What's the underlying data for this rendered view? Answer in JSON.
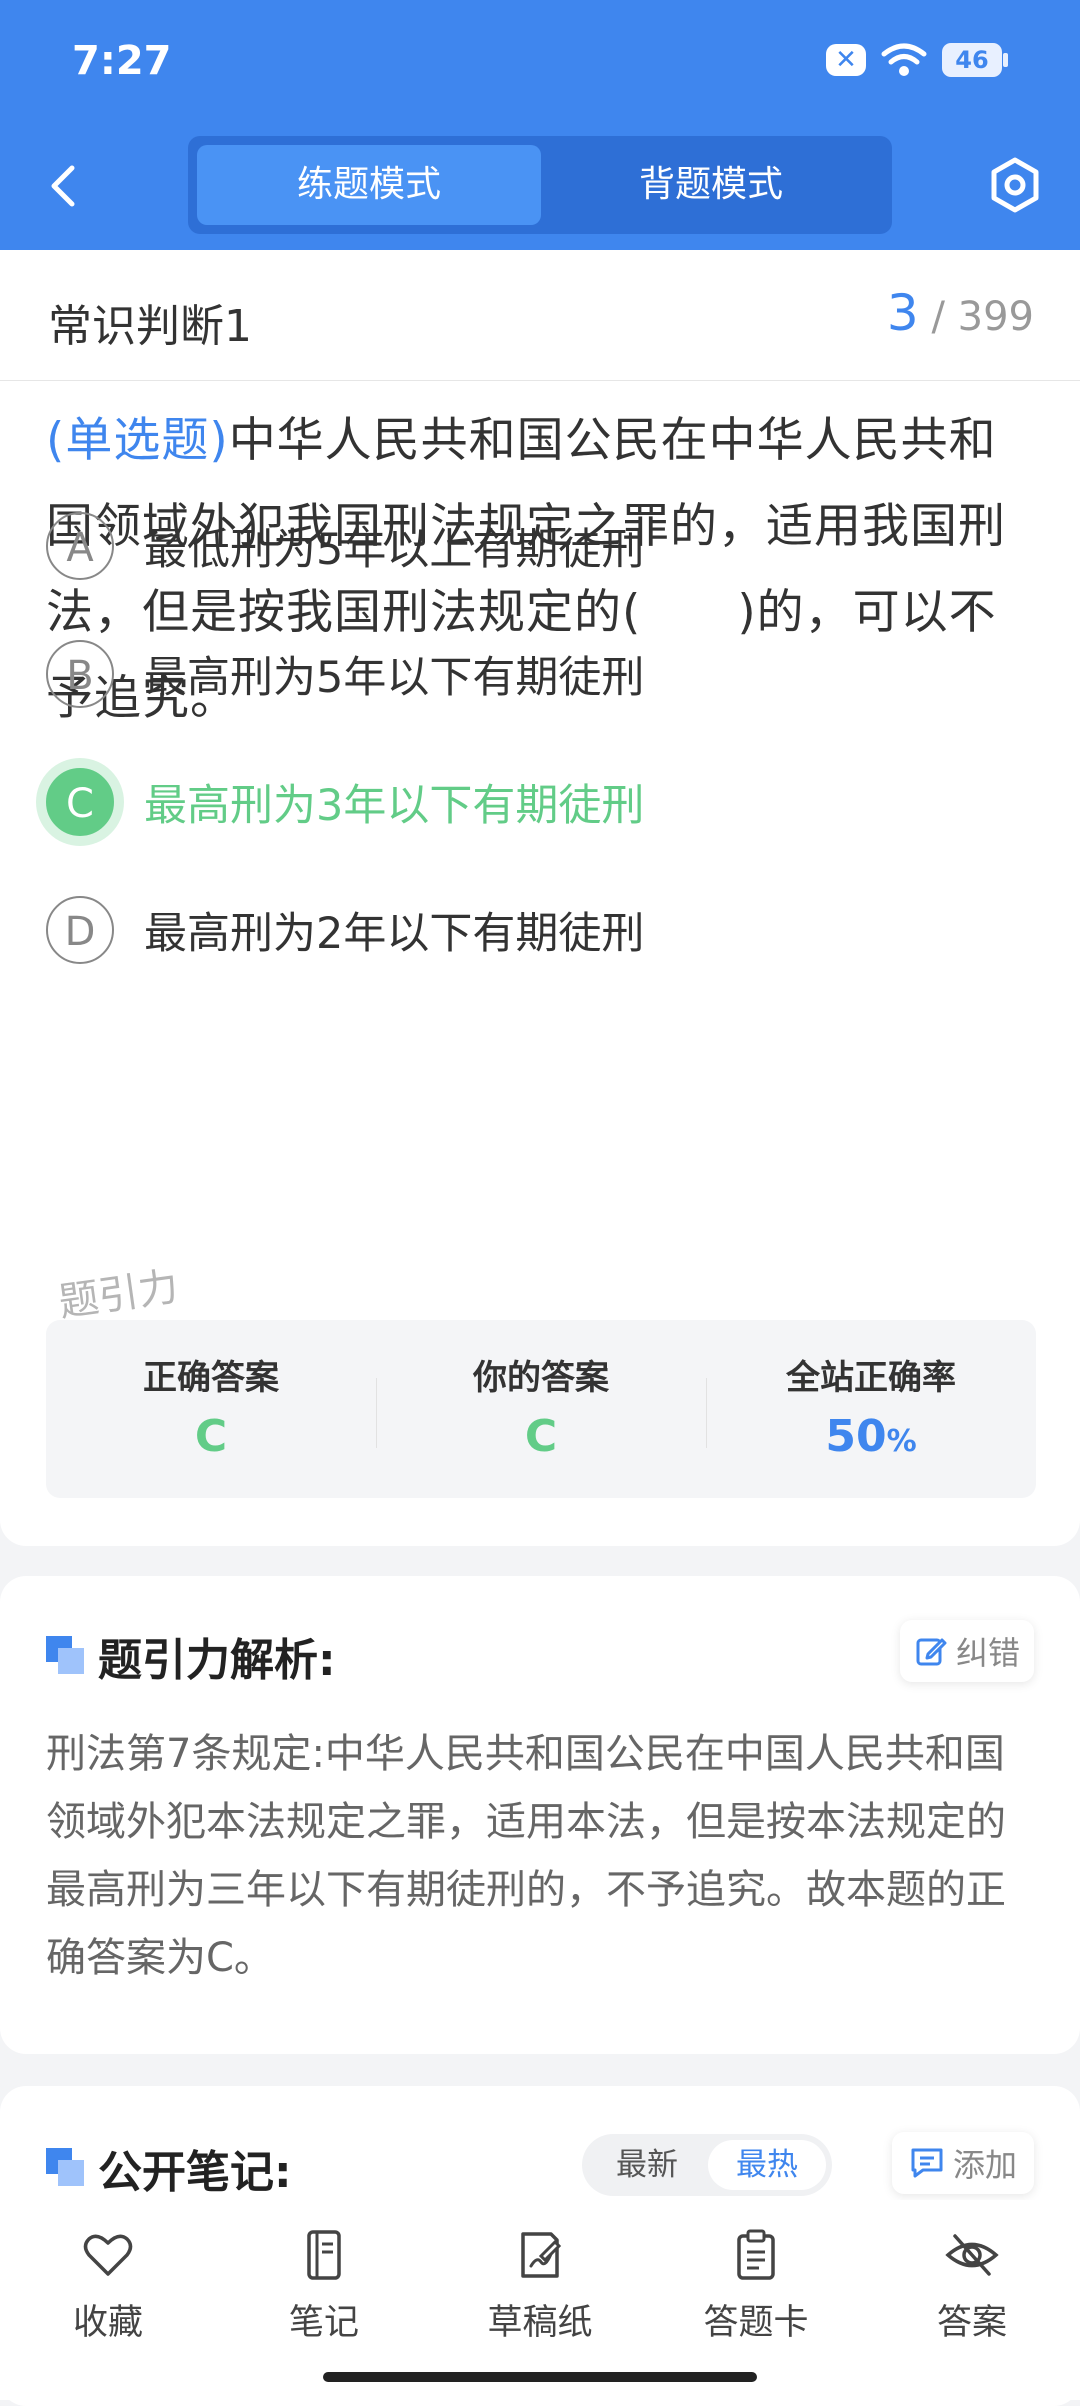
{
  "status_bar": {
    "time": "7:27",
    "battery": "46",
    "notification_icon": "x-icon"
  },
  "header": {
    "tabs": [
      {
        "label": "练题模式",
        "active": true
      },
      {
        "label": "背题模式",
        "active": false
      }
    ],
    "back_icon": "chevron-left-icon",
    "settings_icon": "gear-hex-icon"
  },
  "section": {
    "title": "常识判断1",
    "current": "3",
    "total": "/ 399"
  },
  "question": {
    "type": "(单选题)",
    "text": "中华人民共和国公民在中华人民共和国领域外犯我国刑法规定之罪的，适用我国刑法，但是按我国刑法规定的(　　)的，可以不予追究。"
  },
  "options": [
    {
      "key": "A",
      "text": "最低刑为5年以上有期徒刑",
      "correct": false
    },
    {
      "key": "B",
      "text": "最高刑为5年以下有期徒刑",
      "correct": false
    },
    {
      "key": "C",
      "text": "最高刑为3年以下有期徒刑",
      "correct": true
    },
    {
      "key": "D",
      "text": "最高刑为2年以下有期徒刑",
      "correct": false
    }
  ],
  "watermark": "题引力",
  "stats": {
    "correct_label": "正确答案",
    "correct_value": "C",
    "your_label": "你的答案",
    "your_value": "C",
    "rate_label": "全站正确率",
    "rate_value": "50",
    "rate_unit": "%"
  },
  "analysis": {
    "title": "题引力解析:",
    "correct_btn": "纠错",
    "text": "刑法第7条规定:中华人民共和国公民在中国人民共和国领域外犯本法规定之罪，适用本法，但是按本法规定的最高刑为三年以下有期徒刑的，不予追究。故本题的正确答案为C。"
  },
  "notes": {
    "title": "公开笔记:",
    "sort": [
      "最新",
      "最热"
    ],
    "add_btn": "添加"
  },
  "bottom_nav": [
    {
      "label": "收藏",
      "icon": "heart-icon"
    },
    {
      "label": "笔记",
      "icon": "notebook-icon"
    },
    {
      "label": "草稿纸",
      "icon": "draft-paper-icon"
    },
    {
      "label": "答题卡",
      "icon": "clipboard-icon"
    },
    {
      "label": "答案",
      "icon": "eye-off-icon"
    }
  ],
  "colors": {
    "primary": "#3f86ee",
    "correct": "#62cc87"
  }
}
